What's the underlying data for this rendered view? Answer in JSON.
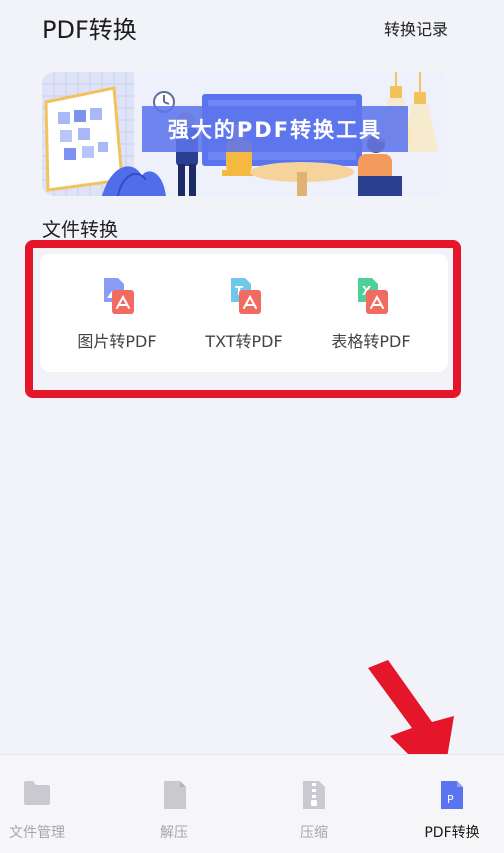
{
  "header": {
    "title": "PDF转换",
    "history_label": "转换记录"
  },
  "banner": {
    "title": "强大的PDF转换工具"
  },
  "section": {
    "label": "文件转换"
  },
  "tools": [
    {
      "label": "图片转PDF",
      "icon": "image-to-pdf-icon"
    },
    {
      "label": "TXT转PDF",
      "icon": "txt-to-pdf-icon"
    },
    {
      "label": "表格转PDF",
      "icon": "excel-to-pdf-icon"
    }
  ],
  "nav": {
    "items": [
      {
        "label": "文件管理",
        "icon": "folder-icon"
      },
      {
        "label": "解压",
        "icon": "unzip-file-icon"
      },
      {
        "label": "压缩",
        "icon": "zip-file-icon"
      },
      {
        "label": "PDF转换",
        "icon": "pdf-convert-icon",
        "active": true
      }
    ]
  },
  "colors": {
    "accent": "#5a73ee",
    "highlight": "#e5152a",
    "pdf_red": "#f26b61",
    "background": "#f2f3f8"
  }
}
